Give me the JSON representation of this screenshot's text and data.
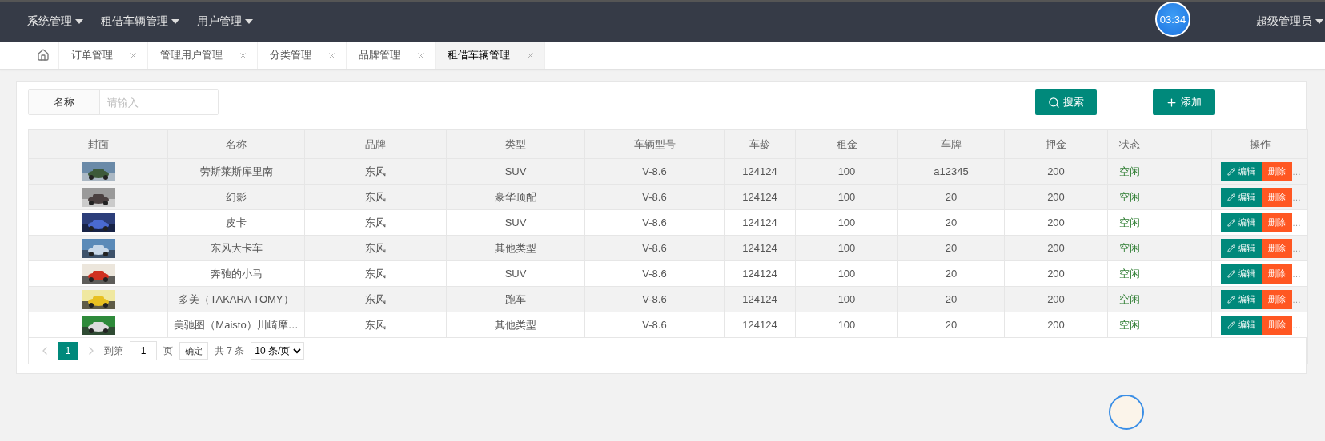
{
  "top_nav": {
    "menus": [
      {
        "label": "系统管理"
      },
      {
        "label": "租借车辆管理"
      },
      {
        "label": "用户管理"
      }
    ],
    "timer": "03:34",
    "user": "超级管理员"
  },
  "tabs": [
    {
      "label": "订单管理",
      "selected": false
    },
    {
      "label": "管理用户管理",
      "selected": false
    },
    {
      "label": "分类管理",
      "selected": false
    },
    {
      "label": "品牌管理",
      "selected": false
    },
    {
      "label": "租借车辆管理",
      "selected": true
    }
  ],
  "search": {
    "label": "名称",
    "placeholder": "请输入",
    "search_button": "搜索",
    "add_button": "添加"
  },
  "table": {
    "columns": [
      "封面",
      "名称",
      "品牌",
      "类型",
      "车辆型号",
      "车龄",
      "租金",
      "车牌",
      "押金",
      "状态",
      "操作"
    ],
    "rows": [
      {
        "name": "劳斯莱斯库里南",
        "brand": "东风",
        "type": "SUV",
        "model": "V-8.6",
        "age": "124124",
        "rent": "100",
        "plate": "a12345",
        "deposit": "200",
        "status": "空闲",
        "highlighted": true,
        "edit": "编辑",
        "delete": "删除",
        "more": "…"
      },
      {
        "name": "幻影",
        "brand": "东风",
        "type": "豪华顶配",
        "model": "V-8.6",
        "age": "124124",
        "rent": "100",
        "plate": "20",
        "deposit": "200",
        "status": "空闲",
        "highlighted": true,
        "edit": "编辑",
        "delete": "删除",
        "more": "…"
      },
      {
        "name": "皮卡",
        "brand": "东风",
        "type": "SUV",
        "model": "V-8.6",
        "age": "124124",
        "rent": "100",
        "plate": "20",
        "deposit": "200",
        "status": "空闲",
        "highlighted": false,
        "edit": "编辑",
        "delete": "删除",
        "more": "…"
      },
      {
        "name": "东风大卡车",
        "brand": "东风",
        "type": "其他类型",
        "model": "V-8.6",
        "age": "124124",
        "rent": "100",
        "plate": "20",
        "deposit": "200",
        "status": "空闲",
        "highlighted": true,
        "edit": "编辑",
        "delete": "删除",
        "more": "…"
      },
      {
        "name": "奔驰的小马",
        "brand": "东风",
        "type": "SUV",
        "model": "V-8.6",
        "age": "124124",
        "rent": "100",
        "plate": "20",
        "deposit": "200",
        "status": "空闲",
        "highlighted": false,
        "edit": "编辑",
        "delete": "删除",
        "more": "…"
      },
      {
        "name": "多美（TAKARA TOMY）",
        "brand": "东风",
        "type": "跑车",
        "model": "V-8.6",
        "age": "124124",
        "rent": "100",
        "plate": "20",
        "deposit": "200",
        "status": "空闲",
        "highlighted": true,
        "edit": "编辑",
        "delete": "删除",
        "more": "…"
      },
      {
        "name": "美驰图（Maisto）川崎摩…",
        "brand": "东风",
        "type": "其他类型",
        "model": "V-8.6",
        "age": "124124",
        "rent": "100",
        "plate": "20",
        "deposit": "200",
        "status": "空闲",
        "highlighted": false,
        "edit": "编辑",
        "delete": "删除",
        "more": "…"
      }
    ]
  },
  "pagination": {
    "prev_disabled": true,
    "pages": [
      {
        "label": "1",
        "selected": true
      }
    ],
    "next_disabled": true,
    "goto_label": "到第",
    "goto_value": "1",
    "page_label": "页",
    "confirm": "确定",
    "total": "共 7 条",
    "page_size": "10 条/页"
  }
}
